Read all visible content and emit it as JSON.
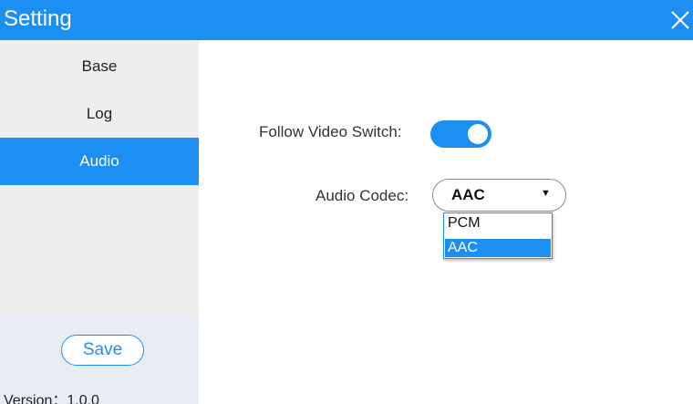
{
  "window": {
    "title": "Setting",
    "close_icon": "close-icon"
  },
  "sidebar": {
    "items": [
      {
        "label": "Base",
        "active": false
      },
      {
        "label": "Log",
        "active": false
      },
      {
        "label": "Audio",
        "active": true
      }
    ],
    "save_label": "Save",
    "version_text": "Version：1.0.0"
  },
  "audio": {
    "follow_video_switch": {
      "label": "Follow Video Switch:",
      "enabled": true
    },
    "audio_codec": {
      "label": "Audio Codec:",
      "value": "AAC",
      "options": [
        "PCM",
        "AAC"
      ],
      "selected_index": 1
    }
  },
  "colors": {
    "accent": "#1e8ff2",
    "sidebar_bg": "#eeeeee",
    "sidebar_footer_bg": "#e8ecf5"
  }
}
